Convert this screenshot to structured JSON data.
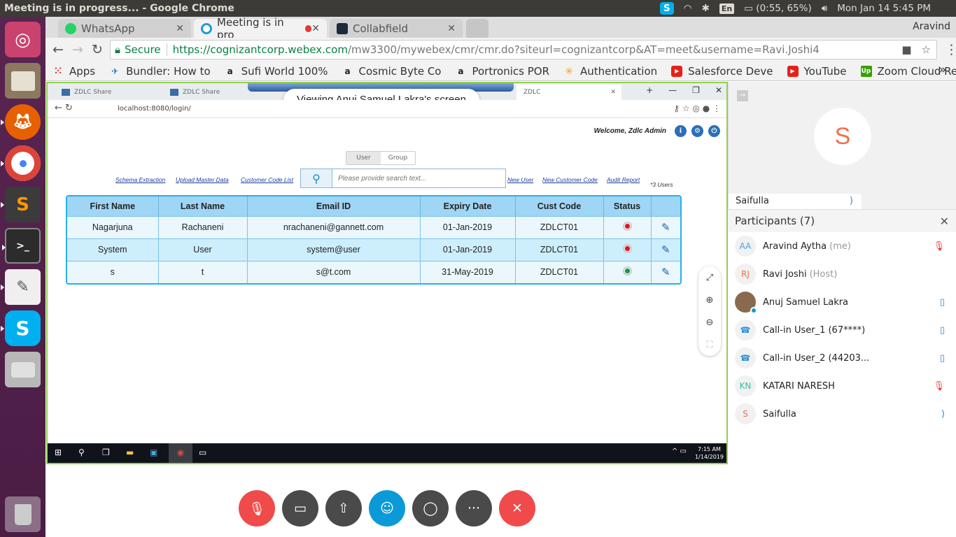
{
  "os_bar": {
    "window_title": "Meeting is in progress... - Google Chrome",
    "keyboard": "En",
    "battery": "(0:55, 65%)",
    "clock": "Mon Jan 14  5:45 PM"
  },
  "launcher": [
    "ubuntu-dash",
    "files",
    "firefox",
    "chrome",
    "sublime-text",
    "terminal",
    "text-editor",
    "skype",
    "disk",
    "trash"
  ],
  "chrome": {
    "tabs": [
      {
        "label": "WhatsApp",
        "active": false
      },
      {
        "label": "Meeting is in pro",
        "active": true
      },
      {
        "label": "Collabfield",
        "active": false
      }
    ],
    "profile": "Aravind",
    "secure_label": "Secure",
    "url_host": "https://cognizantcorp.webex.com",
    "url_path": "/mw3300/mywebex/cmr/cmr.do?siteurl=cognizantcorp&AT=meet&username=Ravi.Joshi4",
    "bookmarks": [
      "Apps",
      "Bundler: How to",
      "Sufi World 100%",
      "Cosmic Byte Co",
      "Portronics POR",
      "Authentication",
      "Salesforce Deve",
      "YouTube",
      "Zoom Cloud Rec"
    ]
  },
  "shared_screen": {
    "banner": "Viewing Anuj Samuel Lakra's screen",
    "inner_tabs": [
      "ZDLC Share",
      "ZDLC Share",
      "ZDLC"
    ],
    "inner_url": "localhost:8080/login/",
    "welcome": "Welcome, Zdlc Admin",
    "segment": {
      "user": "User",
      "group": "Group"
    },
    "links": [
      "Schema Extraction",
      "Upload Master Data",
      "Customer Code List",
      "New User",
      "New Customer Code",
      "Audit Report"
    ],
    "search_placeholder": "Please provide search text...",
    "user_count": "*3 Users",
    "table": {
      "headers": [
        "First Name",
        "Last Name",
        "Email ID",
        "Expiry Date",
        "Cust Code",
        "Status"
      ],
      "rows": [
        {
          "first": "Nagarjuna",
          "last": "Rachaneni",
          "email": "nrachaneni@gannett.com",
          "expiry": "01-Jan-2019",
          "code": "ZDLCT01",
          "status": "red"
        },
        {
          "first": "System",
          "last": "User",
          "email": "system@user",
          "expiry": "01-Jan-2019",
          "code": "ZDLCT01",
          "status": "red"
        },
        {
          "first": "s",
          "last": "t",
          "email": "s@t.com",
          "expiry": "31-May-2019",
          "code": "ZDLCT01",
          "status": "green"
        }
      ]
    },
    "taskbar_time": "7:15 AM",
    "taskbar_date": "1/14/2019"
  },
  "video": {
    "initial": "S",
    "name": "Saifulla"
  },
  "participants": {
    "header": "Participants (7)",
    "list": [
      {
        "initials": "AA",
        "name": "Aravind Aytha",
        "role": "(me)",
        "color": "#4aa3df",
        "mic": "muted"
      },
      {
        "initials": "RJ",
        "name": "Ravi Joshi",
        "role": "(Host)",
        "color": "#ef6f4b",
        "mic": "none"
      },
      {
        "initials": "",
        "name": "Anuj Samuel Lakra",
        "role": "",
        "color": "#444444",
        "mic": "on"
      },
      {
        "initials": "",
        "name": "Call-in User_1 (67****)",
        "role": "",
        "color": "#2a8fd6",
        "mic": "on"
      },
      {
        "initials": "",
        "name": "Call-in User_2 (44203...",
        "role": "",
        "color": "#2a8fd6",
        "mic": "on"
      },
      {
        "initials": "KN",
        "name": "KATARI NARESH",
        "role": "",
        "color": "#3bbfa0",
        "mic": "muted"
      },
      {
        "initials": "S",
        "name": "Saifulla",
        "role": "",
        "color": "#ef6f4b",
        "mic": "speaking"
      }
    ]
  },
  "controls": [
    {
      "name": "mute",
      "color": "#f04a4a"
    },
    {
      "name": "video",
      "color": "#4a4a4a"
    },
    {
      "name": "share",
      "color": "#4a4a4a"
    },
    {
      "name": "participants",
      "color": "#0a9ad8"
    },
    {
      "name": "chat",
      "color": "#4a4a4a"
    },
    {
      "name": "more",
      "color": "#4a4a4a"
    },
    {
      "name": "leave",
      "color": "#f04a4a"
    }
  ]
}
